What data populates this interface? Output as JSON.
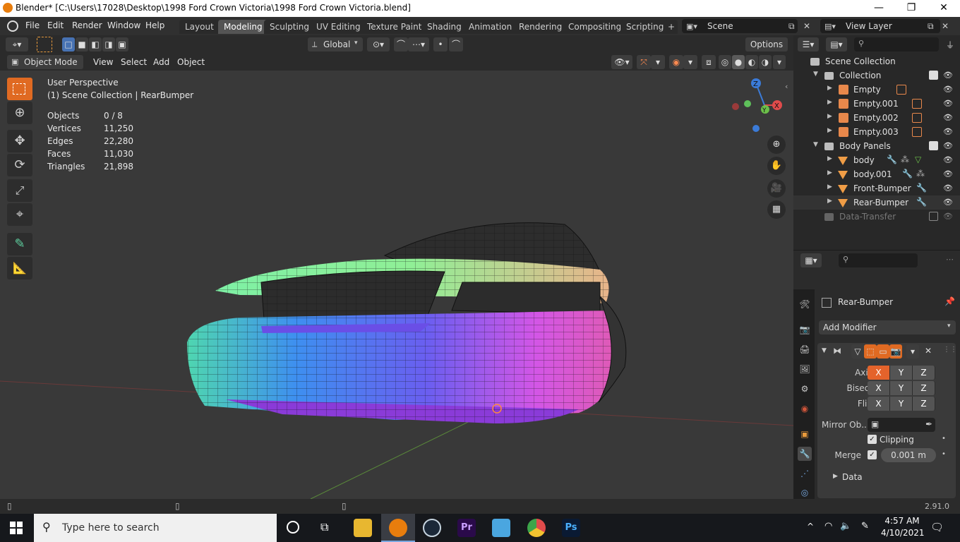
{
  "window": {
    "title": "Blender* [C:\\Users\\17028\\Desktop\\1998 Ford Crown Victoria\\1998 Ford Crown Victoria.blend]",
    "minimize": "—",
    "maximize": "❐",
    "close": "✕"
  },
  "menu": [
    "File",
    "Edit",
    "Render",
    "Window",
    "Help"
  ],
  "workspaces": [
    "Layout",
    "Modeling",
    "Sculpting",
    "UV Editing",
    "Texture Paint",
    "Shading",
    "Animation",
    "Rendering",
    "Compositing",
    "Scripting"
  ],
  "active_workspace": "Modeling",
  "add_workspace": "+",
  "scene_field": "Scene",
  "view_layer_field": "View Layer",
  "toolbar1": {
    "transform_orientation": "Global",
    "options": "Options"
  },
  "toolbar2": {
    "mode": "Object Mode",
    "items": [
      "View",
      "Select",
      "Add",
      "Object"
    ]
  },
  "viewport": {
    "view_name": "User Perspective",
    "collection_path": "(1) Scene Collection | RearBumper",
    "stats": [
      {
        "label": "Objects",
        "value": "0 / 8"
      },
      {
        "label": "Vertices",
        "value": "11,250"
      },
      {
        "label": "Edges",
        "value": "22,280"
      },
      {
        "label": "Faces",
        "value": "11,030"
      },
      {
        "label": "Triangles",
        "value": "21,898"
      }
    ],
    "gizmo_axes": {
      "x": "X",
      "y": "Y",
      "z": "Z"
    }
  },
  "outliner": {
    "search_placeholder": "",
    "scene_collection": "Scene Collection",
    "collections": [
      {
        "name": "Collection",
        "checked": true,
        "children": [
          {
            "name": "Empty",
            "type": "empty"
          },
          {
            "name": "Empty.001",
            "type": "empty"
          },
          {
            "name": "Empty.002",
            "type": "empty"
          },
          {
            "name": "Empty.003",
            "type": "empty"
          }
        ]
      },
      {
        "name": "Body Panels",
        "checked": true,
        "children": [
          {
            "name": "body",
            "type": "mesh"
          },
          {
            "name": "body.001",
            "type": "mesh"
          },
          {
            "name": "Front-Bumper",
            "type": "mesh"
          },
          {
            "name": "Rear-Bumper",
            "type": "mesh"
          }
        ]
      }
    ],
    "data_transfer": "Data-Transfer"
  },
  "properties": {
    "object_name": "Rear-Bumper",
    "add_modifier": "Add Modifier",
    "axis_label": "Axis",
    "bisect_label": "Bisect",
    "flip_label": "Flip",
    "axis_buttons": [
      "X",
      "Y",
      "Z"
    ],
    "mirror_object_label": "Mirror Ob...",
    "clipping_label": "Clipping",
    "merge_label": "Merge",
    "merge_value": "0.001 m",
    "data_label": "Data"
  },
  "statusbar": {
    "version": "2.91.0"
  },
  "taskbar": {
    "search_placeholder": "Type here to search",
    "time": "4:57 AM",
    "date": "4/10/2021"
  },
  "colors": {
    "accent_orange": "#e06a22",
    "active_blue": "#4772b3",
    "axis_x_red": "#e4632b",
    "viewport_bg": "#393939"
  }
}
